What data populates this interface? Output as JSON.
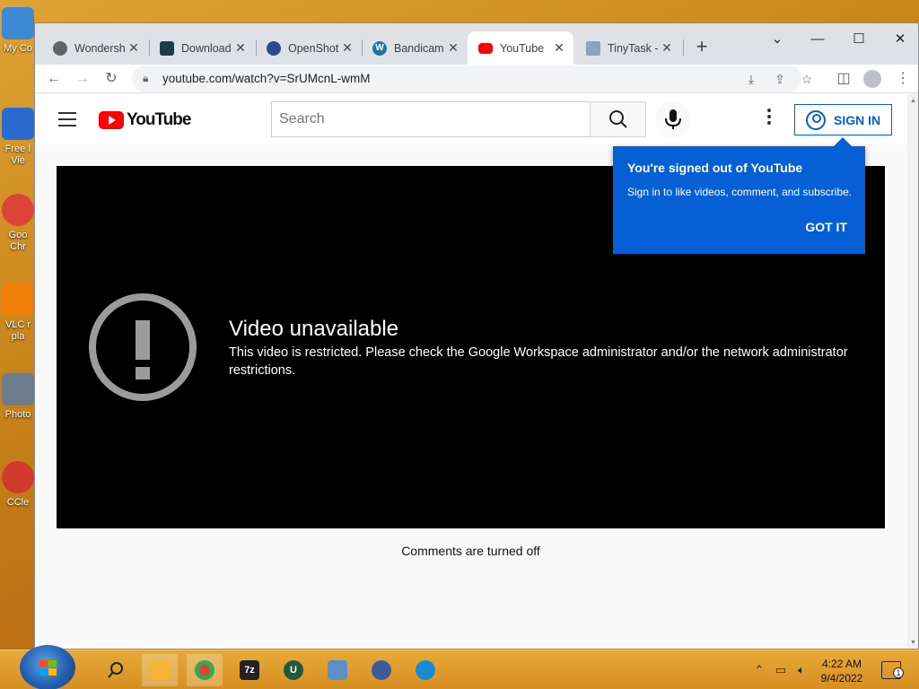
{
  "desktop": {
    "icons": [
      {
        "label": "My Co",
        "color": "#3f88d6"
      },
      {
        "label": "Free I",
        "sub": "Vie",
        "color": "#2a6bd1"
      },
      {
        "label": "Goo",
        "sub": "Chr",
        "color": "#db4437"
      },
      {
        "label": "VLC r",
        "sub": "pla",
        "color": "#f07f0a"
      },
      {
        "label": "Photo",
        "color": "#6c7c8c"
      },
      {
        "label": "CCle",
        "color": "#d03a2a"
      }
    ]
  },
  "browser": {
    "tabs": [
      {
        "title": "Wondersh",
        "favicon": "globe-icon",
        "color": "#5f6368"
      },
      {
        "title": "Download",
        "favicon": "filmora-icon",
        "color": "#1f3a48"
      },
      {
        "title": "OpenShot",
        "favicon": "openshot-icon",
        "color": "#2b4a8a"
      },
      {
        "title": "Bandicam",
        "favicon": "wordpress-icon",
        "color": "#21759b"
      },
      {
        "title": "YouTube",
        "favicon": "youtube-icon",
        "color": "#ff0000",
        "active": true
      },
      {
        "title": "TinyTask -",
        "favicon": "tinytask-icon",
        "color": "#8aa4c0"
      }
    ],
    "new_tab": "+",
    "url": "youtube.com/watch?v=SrUMcnL-wmM"
  },
  "youtube": {
    "logo_text": "YouTube",
    "search_placeholder": "Search",
    "sign_in": "SIGN IN",
    "error_title": "Video unavailable",
    "error_message": "This video is restricted. Please check the Google Workspace administrator and/or the network administrator restrictions.",
    "popup": {
      "title": "You're signed out of YouTube",
      "body": "Sign in to like videos, comment, and subscribe.",
      "button": "GOT IT"
    },
    "comments": "Comments are turned off"
  },
  "taskbar": {
    "apps": [
      {
        "name": "file-explorer-icon",
        "color": "#f2b632"
      },
      {
        "name": "chrome-icon",
        "color": "#db4437"
      },
      {
        "name": "7zip-icon",
        "label": "7z",
        "color": "#222222"
      },
      {
        "name": "uget-icon",
        "label": "U",
        "color": "#1f5a3a"
      },
      {
        "name": "photos-icon",
        "color": "#5b8fc8"
      },
      {
        "name": "globe-app-icon",
        "color": "#3a5b9e"
      },
      {
        "name": "edge-icon",
        "color": "#1a8ad4"
      }
    ],
    "time": "4:22 AM",
    "date": "9/4/2022",
    "notifications": "1"
  }
}
